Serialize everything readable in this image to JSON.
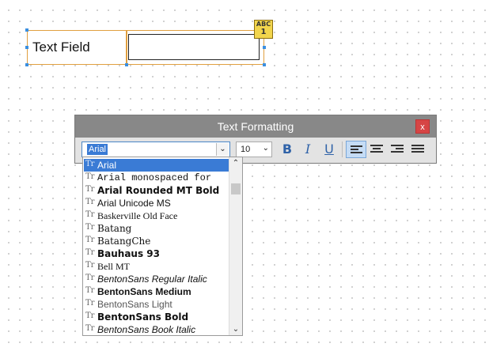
{
  "canvas_widget": {
    "label_text": "Text Field",
    "badge_line1": "ABC",
    "badge_line2": "1"
  },
  "text_formatting": {
    "title": "Text Formatting",
    "close_label": "x",
    "font_value": "Arial",
    "size_value": "10",
    "bold_label": "B",
    "italic_label": "I",
    "underline_label": "U",
    "align_active": "left"
  },
  "font_dropdown": {
    "items": [
      {
        "name": "Arial",
        "selected": true
      },
      {
        "name": "Arial monospaced for"
      },
      {
        "name": "Arial Rounded MT Bold"
      },
      {
        "name": "Arial Unicode MS"
      },
      {
        "name": "Baskerville Old Face"
      },
      {
        "name": "Batang"
      },
      {
        "name": "BatangChe"
      },
      {
        "name": "Bauhaus 93"
      },
      {
        "name": "Bell MT"
      },
      {
        "name": "BentonSans Regular Italic"
      },
      {
        "name": "BentonSans Medium"
      },
      {
        "name": "BentonSans Light"
      },
      {
        "name": "BentonSans Bold"
      },
      {
        "name": "BentonSans Book Italic"
      }
    ],
    "font_type_icon": "truetype-font-icon"
  },
  "colors": {
    "selection": "#3a7bd5",
    "titlebar": "#888888",
    "close": "#d64545",
    "widget_border": "#e0a040",
    "handle": "#3b8fe0"
  }
}
